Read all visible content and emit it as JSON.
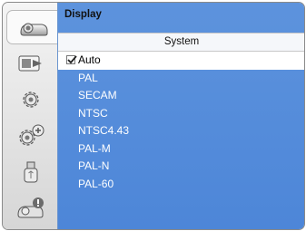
{
  "menu": {
    "title": "Display",
    "section": "System"
  },
  "sidebar": {
    "items": [
      {
        "icon": "projector-icon",
        "active": true
      },
      {
        "icon": "input-icon"
      },
      {
        "icon": "gear-icon"
      },
      {
        "icon": "advanced-settings-icon"
      },
      {
        "icon": "usb-icon"
      },
      {
        "icon": "info-icon"
      }
    ]
  },
  "options": [
    {
      "label": "Auto",
      "checked": true
    },
    {
      "label": "PAL"
    },
    {
      "label": "SECAM"
    },
    {
      "label": "NTSC"
    },
    {
      "label": "NTSC4.43"
    },
    {
      "label": "PAL-M"
    },
    {
      "label": "PAL-N"
    },
    {
      "label": "PAL-60"
    }
  ],
  "colors": {
    "panel": "#5a90dc",
    "selected_row": "#ffffff"
  }
}
